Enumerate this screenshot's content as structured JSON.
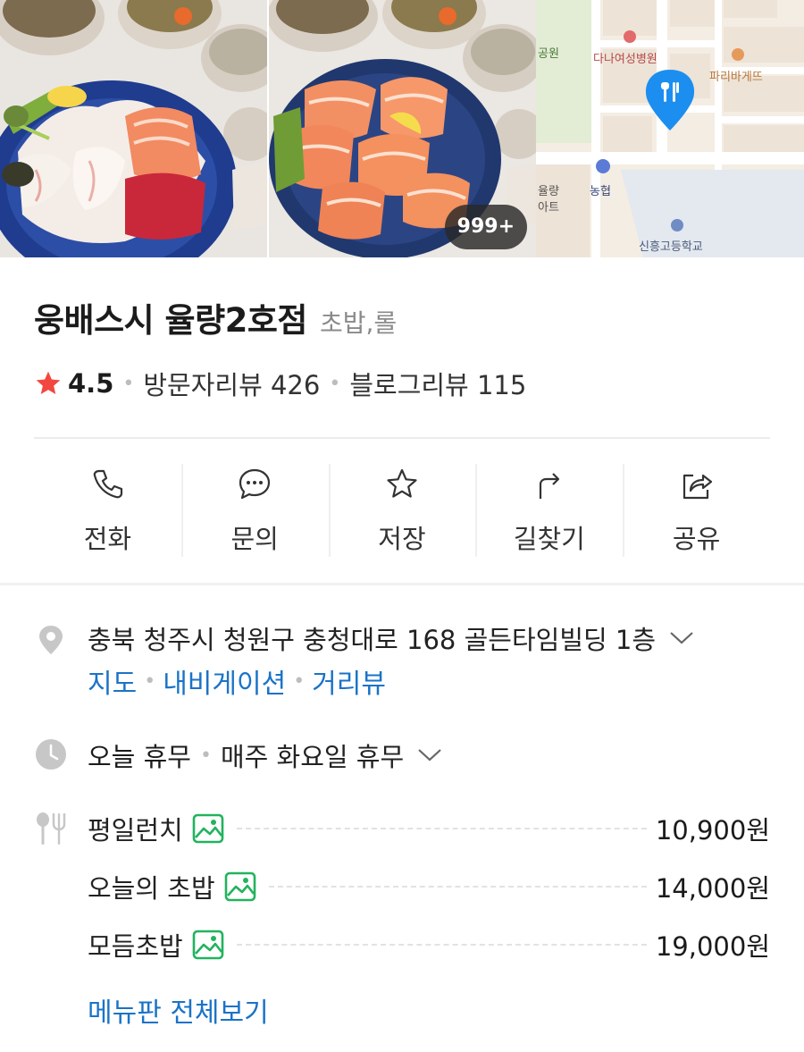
{
  "photos": {
    "more_count": "999+",
    "map_labels": {
      "park": "공원",
      "hospital": "다나여성병원",
      "bakery": "파리바게뜨",
      "bank": "농협",
      "apt": "율량",
      "apt2": "아트",
      "school": "신흥고등학교"
    }
  },
  "place": {
    "name": "웅배스시 율량2호점",
    "category": "초밥,롤",
    "rating": "4.5",
    "visitor_reviews": "방문자리뷰 426",
    "blog_reviews": "블로그리뷰 115"
  },
  "actions": [
    {
      "label": "전화",
      "icon": "phone-icon"
    },
    {
      "label": "문의",
      "icon": "chat-icon"
    },
    {
      "label": "저장",
      "icon": "star-outline-icon"
    },
    {
      "label": "길찾기",
      "icon": "directions-icon"
    },
    {
      "label": "공유",
      "icon": "share-icon"
    }
  ],
  "address": {
    "text": "충북 청주시 청원구 충청대로 168 골든타임빌딩 1층",
    "links": [
      "지도",
      "내비게이션",
      "거리뷰"
    ]
  },
  "hours": {
    "status": "오늘 휴무",
    "detail": "매주 화요일 휴무"
  },
  "menu": {
    "items": [
      {
        "name": "평일런치",
        "price": "10,900원"
      },
      {
        "name": "오늘의 초밥",
        "price": "14,000원"
      },
      {
        "name": "모듬초밥",
        "price": "19,000원"
      }
    ],
    "view_all": "메뉴판 전체보기"
  },
  "colors": {
    "star": "#f2473f",
    "link": "#1a73c8",
    "map_pin": "#1c8ef0",
    "photo_icon": "#22b35e"
  }
}
